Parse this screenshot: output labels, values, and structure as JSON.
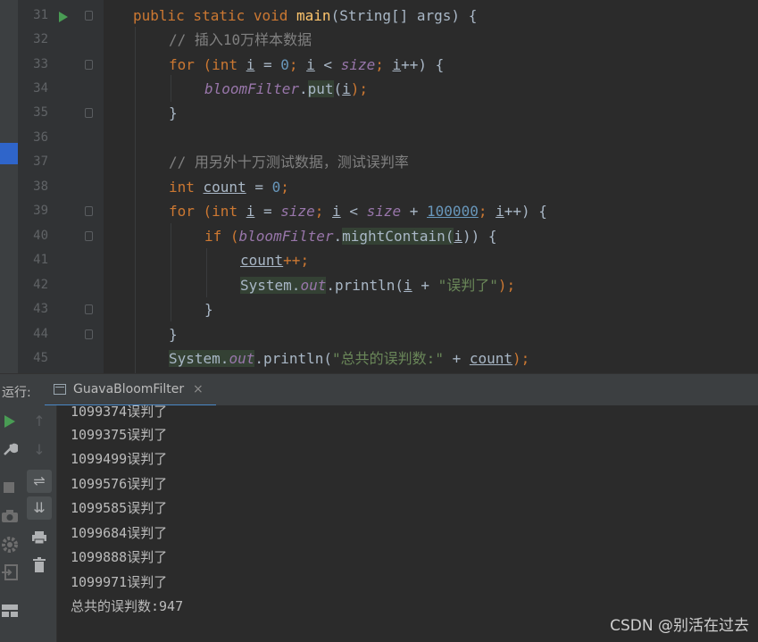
{
  "editor": {
    "lines": [
      {
        "num": "31"
      },
      {
        "num": "32"
      },
      {
        "num": "33"
      },
      {
        "num": "34"
      },
      {
        "num": "35"
      },
      {
        "num": "36"
      },
      {
        "num": "37"
      },
      {
        "num": "38"
      },
      {
        "num": "39"
      },
      {
        "num": "40"
      },
      {
        "num": "41"
      },
      {
        "num": "42"
      },
      {
        "num": "43"
      },
      {
        "num": "44"
      },
      {
        "num": "45"
      }
    ],
    "code": {
      "l31": [
        "public static void ",
        "main",
        "(String[] args) {"
      ],
      "l32": "// 插入10万样本数据",
      "l33": [
        "for (",
        "int ",
        "i",
        " = ",
        "0",
        "; ",
        "i",
        " < ",
        "size",
        "; ",
        "i",
        "++) {"
      ],
      "l34": [
        "bloomFilter",
        ".",
        "put",
        "(",
        "i",
        ");"
      ],
      "l35": "}",
      "l37": "// 用另外十万测试数据，测试误判率",
      "l38": [
        "int ",
        "count",
        " = ",
        "0",
        ";"
      ],
      "l39": [
        "for (",
        "int ",
        "i",
        " = ",
        "size",
        "; ",
        "i",
        " < ",
        "size",
        " + ",
        "100000",
        "; ",
        "i",
        "++) {"
      ],
      "l40": [
        "if (",
        "bloomFilter",
        ".",
        "mightContain",
        "(",
        "i",
        ")) {"
      ],
      "l41": [
        "count",
        "++;"
      ],
      "l42": [
        "System.",
        "out",
        ".println(",
        "i",
        " + ",
        "\"误判了\"",
        ");"
      ],
      "l43": "}",
      "l44": "}",
      "l45": [
        "System.",
        "out",
        ".println(",
        "\"总共的误判数:\"",
        " + ",
        "count",
        ");"
      ]
    }
  },
  "run_panel": {
    "label": "运行:",
    "tab_label": "GuavaBloomFilter",
    "tab_close": "×",
    "output": [
      "1099374误判了",
      "1099375误判了",
      "1099499误判了",
      "1099576误判了",
      "1099585误判了",
      "1099684误判了",
      "1099888误判了",
      "1099971误判了",
      "总共的误判数:947"
    ]
  },
  "watermark": "CSDN @别活在过去",
  "colors": {
    "background": "#2b2b2b",
    "keyword": "#cc7832",
    "function": "#ffc66d",
    "comment": "#808080",
    "number": "#6897bb",
    "string": "#6a8759",
    "field": "#9876aa",
    "run_green": "#499c54"
  }
}
